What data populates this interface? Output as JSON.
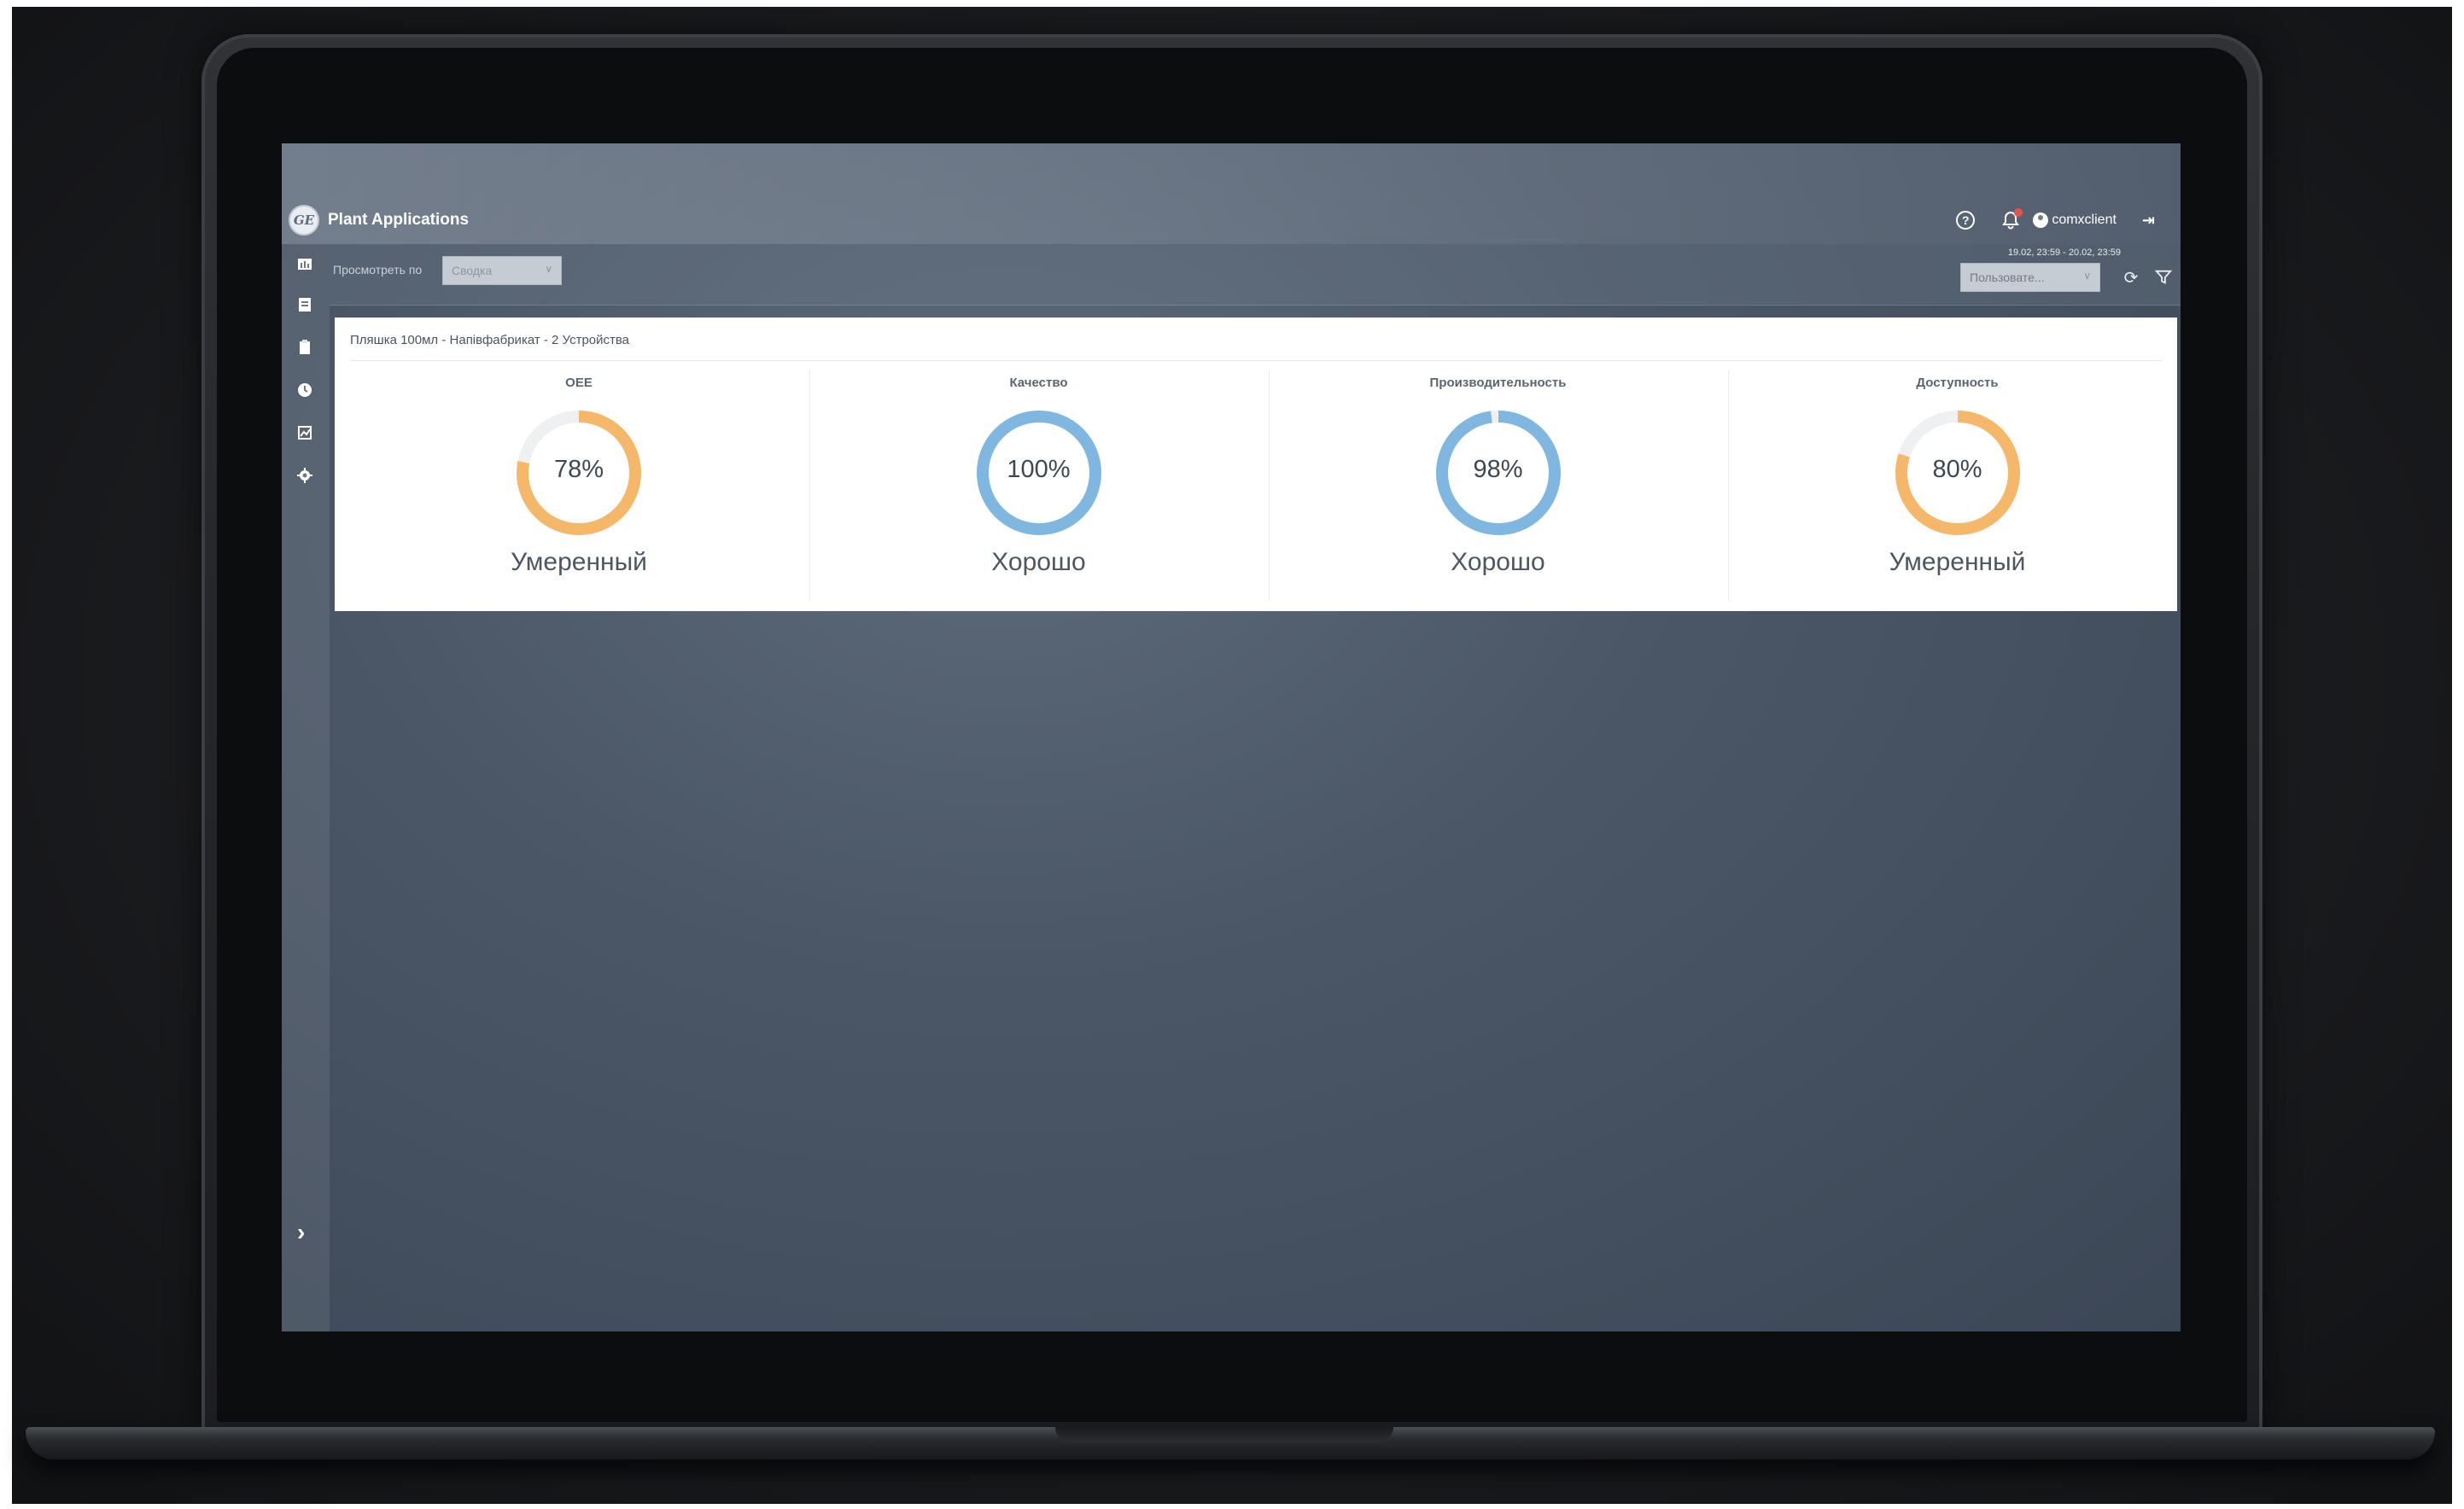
{
  "app": {
    "title": "Plant Applications",
    "logo_text": "GE"
  },
  "header": {
    "username": "comxclient",
    "icons": [
      "help-icon",
      "bell-icon",
      "user-icon",
      "logout-icon"
    ],
    "notification_color": "#e8534a"
  },
  "filters": {
    "view_label": "Просмотреть по",
    "view_value": "Сводка",
    "date_range": "19.02, 23:59 - 20.02, 23:59",
    "user_value": "Пользовате..."
  },
  "sidebar": {
    "icons": [
      "dashboard-icon",
      "report-icon",
      "clipboard-icon",
      "clock-icon",
      "chart-icon",
      "gear-icon"
    ],
    "expand_icon": "chevron-right-icon"
  },
  "panel": {
    "title": "Пляшка 100мл - Напівфабрикат - 2 Устройства",
    "kpis": [
      {
        "title": "OEE",
        "value": "78%",
        "percent": 78,
        "status": "Умеренный",
        "color": "#f5b86a"
      },
      {
        "title": "Качество",
        "value": "100%",
        "percent": 100,
        "status": "Хорошо",
        "color": "#7fb7e0"
      },
      {
        "title": "Производительность",
        "value": "98%",
        "percent": 98,
        "status": "Хорошо",
        "color": "#7fb7e0"
      },
      {
        "title": "Доступность",
        "value": "80%",
        "percent": 80,
        "status": "Умеренный",
        "color": "#f5b86a"
      }
    ]
  }
}
